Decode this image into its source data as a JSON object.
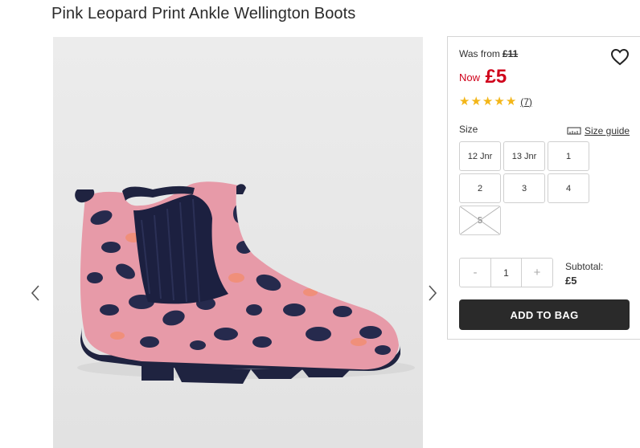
{
  "product": {
    "title": "Pink Leopard Print Ankle Wellington Boots",
    "image_alt": "Pink leopard print ankle wellington boot"
  },
  "pricing": {
    "was_label": "Was from",
    "was_price": "£11",
    "now_label": "Now",
    "now_price": "£5",
    "price_color": "#d0021b"
  },
  "rating": {
    "stars": 5,
    "review_count": "(7)",
    "star_color": "#f3b618"
  },
  "size": {
    "label": "Size",
    "guide_label": "Size guide",
    "options": [
      {
        "label": "12 Jnr",
        "available": true
      },
      {
        "label": "13 Jnr",
        "available": true
      },
      {
        "label": "1",
        "available": true
      },
      {
        "label": "2",
        "available": true
      },
      {
        "label": "3",
        "available": true
      },
      {
        "label": "4",
        "available": true
      },
      {
        "label": "5",
        "available": false
      }
    ]
  },
  "quantity": {
    "minus": "-",
    "value": "1",
    "plus": "+"
  },
  "subtotal": {
    "label": "Subtotal:",
    "amount": "£5"
  },
  "actions": {
    "add_to_bag": "ADD TO BAG"
  },
  "icons": {
    "wishlist": "heart-icon",
    "size_guide": "ruler-icon",
    "prev": "chevron-left-icon",
    "next": "chevron-right-icon"
  }
}
